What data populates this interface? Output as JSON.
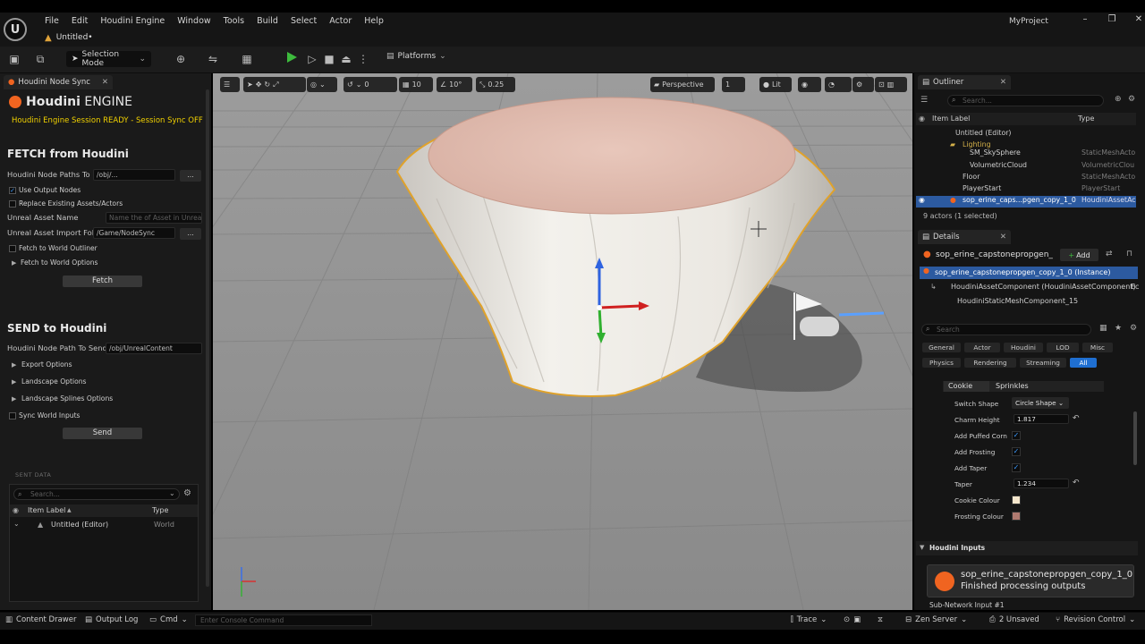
{
  "menu": {
    "items": [
      "File",
      "Edit",
      "Houdini Engine",
      "Window",
      "Tools",
      "Build",
      "Select",
      "Actor",
      "Help"
    ],
    "doc_tab": "Untitled•",
    "project_name": "MyProject",
    "win_min": "–",
    "win_max": "❐",
    "win_close": "✕"
  },
  "toolbar": {
    "selection_mode": "Selection Mode",
    "platforms": "Platforms"
  },
  "left_panel": {
    "tab_title": "Houdini Node Sync",
    "logo_bold": "Houdini",
    "logo_rest": "ENGINE",
    "session_status": "Houdini Engine Session READY - Session Sync OFF",
    "fetch_title": "FETCH from Houdini",
    "node_paths_label": "Houdini Node Paths To F",
    "node_paths_value": "/obj/...",
    "use_output_nodes": "Use Output Nodes",
    "replace_existing": "Replace Existing Assets/Actors",
    "asset_name_label": "Unreal Asset Name",
    "asset_name_placeholder": "Name the of Asset in Unreal",
    "import_folder_label": "Unreal Asset Import Fold",
    "import_folder_value": "/Game/NodeSync",
    "fetch_world_outliner": "Fetch to World Outliner",
    "fetch_world_options": "Fetch to World Options",
    "fetch_button": "Fetch",
    "send_title": "SEND to Houdini",
    "send_path_label": "Houdini Node Path To Send T",
    "send_path_value": "/obj/UnrealContent",
    "export_options": "Export Options",
    "landscape_options": "Landscape Options",
    "landscape_splines": "Landscape Splines Options",
    "sync_world_inputs": "Sync World Inputs",
    "send_button": "Send",
    "sent_data_label": "SENT DATA",
    "sent_search_placeholder": "Search...",
    "col_item_label": "Item Label",
    "col_type": "Type",
    "row_label": "Untitled (Editor)",
    "row_type": "World",
    "dots": "..."
  },
  "viewport": {
    "perspective": "Perspective",
    "lit": "Lit",
    "grid_snap": "10",
    "rot_snap": "10°",
    "scale_snap": "0.25",
    "cam_speed": "1",
    "zero": "0"
  },
  "outliner": {
    "tab_title": "Outliner",
    "search_placeholder": "Search...",
    "col_item_label": "Item Label",
    "col_type": "Type",
    "rows": [
      {
        "label": "Untitled (Editor)",
        "type": ""
      },
      {
        "label": "Lighting",
        "type": ""
      },
      {
        "label": "SM_SkySphere",
        "type": "StaticMeshActo"
      },
      {
        "label": "VolumetricCloud",
        "type": "VolumetricClou"
      },
      {
        "label": "Floor",
        "type": "StaticMeshActo"
      },
      {
        "label": "PlayerStart",
        "type": "PlayerStart"
      },
      {
        "label": "sop_erine_caps...pgen_copy_1_0",
        "type": "HoudiniAssetAc"
      }
    ],
    "summary": "9 actors (1 selected)"
  },
  "details": {
    "tab_title": "Details",
    "actor_name": "sop_erine_capstonepropgen_",
    "add_button": "Add",
    "instance_row": "sop_erine_capstonepropgen_copy_1_0 (Instance)",
    "component_row": "HoudiniAssetComponent (HoudiniAssetComponent)",
    "component_suffix": "Ec",
    "mesh_row": "HoudiniStaticMeshComponent_15",
    "search_placeholder": "Search",
    "categories_row1": [
      "General",
      "Actor",
      "Houdini",
      "LOD",
      "Misc"
    ],
    "categories_row2": [
      "Physics",
      "Rendering",
      "Streaming",
      "All"
    ],
    "subtab_cookie": "Cookie",
    "subtab_sprinkles": "Sprinkles",
    "props": {
      "switch_shape_label": "Switch Shape",
      "switch_shape_value": "Circle Shape",
      "charm_height_label": "Charm Height",
      "charm_height_value": "1.817",
      "add_puffed_corn": "Add Puffed Corn",
      "add_frosting": "Add Frosting",
      "add_taper": "Add Taper",
      "taper_label": "Taper",
      "taper_value": "1.234",
      "cookie_colour_label": "Cookie Colour",
      "frosting_colour_label": "Frosting Colour"
    },
    "houdini_inputs": "Houdini Inputs",
    "subnetwork_input": "Sub-Network Input #1"
  },
  "colors": {
    "cookie": "#f5e6cc",
    "frosting": "#b07a70",
    "accent_blue": "#1f6fd1",
    "houdini_orange": "#f06420"
  },
  "toast": {
    "title": "sop_erine_capstonepropgen_copy_1_0",
    "subtitle": "Finished processing outputs"
  },
  "statusbar": {
    "content_drawer": "Content Drawer",
    "output_log": "Output Log",
    "cmd": "Cmd",
    "console_placeholder": "Enter Console Command",
    "trace": "Trace",
    "zen_server": "Zen Server",
    "unsaved": "2 Unsaved",
    "revision_control": "Revision Control"
  }
}
